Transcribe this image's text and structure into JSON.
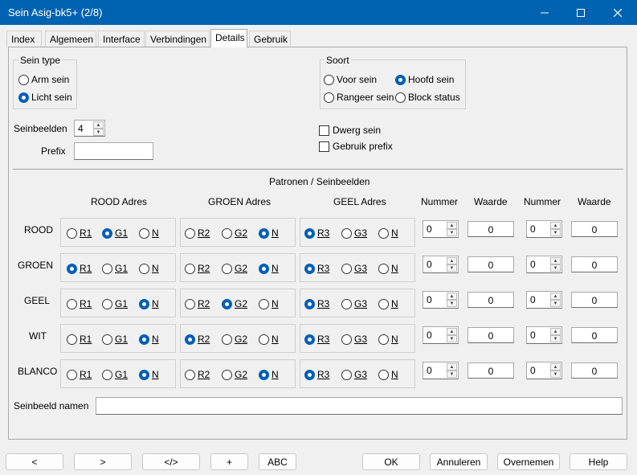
{
  "window": {
    "title": "Sein Asig-bk5+ (2/8)"
  },
  "tabs": [
    "Index",
    "Algemeen",
    "Interface",
    "Verbindingen",
    "Details",
    "Gebruik"
  ],
  "sein_type": {
    "label": "Sein type",
    "options": [
      {
        "label": "Arm sein",
        "selected": false
      },
      {
        "label": "Licht sein",
        "selected": true
      }
    ]
  },
  "soort": {
    "label": "Soort",
    "options": [
      {
        "label": "Voor sein",
        "selected": false
      },
      {
        "label": "Hoofd sein",
        "selected": true
      },
      {
        "label": "Rangeer sein",
        "selected": false
      },
      {
        "label": "Block status",
        "selected": false
      }
    ]
  },
  "seinbeelden": {
    "label": "Seinbeelden",
    "value": "4"
  },
  "prefix": {
    "label": "Prefix",
    "value": ""
  },
  "checkboxes": [
    {
      "label": "Dwerg sein",
      "checked": false
    },
    {
      "label": "Gebruik prefix",
      "checked": false
    }
  ],
  "patronen": {
    "title": "Patronen / Seinbeelden",
    "headers": [
      "ROOD Adres",
      "GROEN Adres",
      "GEEL Adres",
      "Nummer",
      "Waarde",
      "Nummer",
      "Waarde"
    ],
    "rows": [
      {
        "name": "ROOD",
        "rood": [
          "R1",
          "G1",
          "N"
        ],
        "rood_sel": 1,
        "groen": [
          "R2",
          "G2",
          "N"
        ],
        "groen_sel": 2,
        "geel": [
          "R3",
          "G3",
          "N"
        ],
        "geel_sel": 0,
        "n1": "0",
        "w1": "0",
        "n2": "0",
        "w2": "0"
      },
      {
        "name": "GROEN",
        "rood": [
          "R1",
          "G1",
          "N"
        ],
        "rood_sel": 0,
        "groen": [
          "R2",
          "G2",
          "N"
        ],
        "groen_sel": 2,
        "geel": [
          "R3",
          "G3",
          "N"
        ],
        "geel_sel": 0,
        "n1": "0",
        "w1": "0",
        "n2": "0",
        "w2": "0"
      },
      {
        "name": "GEEL",
        "rood": [
          "R1",
          "G1",
          "N"
        ],
        "rood_sel": 2,
        "groen": [
          "R2",
          "G2",
          "N"
        ],
        "groen_sel": 1,
        "geel": [
          "R3",
          "G3",
          "N"
        ],
        "geel_sel": 0,
        "n1": "0",
        "w1": "0",
        "n2": "0",
        "w2": "0"
      },
      {
        "name": "WIT",
        "rood": [
          "R1",
          "G1",
          "N"
        ],
        "rood_sel": 2,
        "groen": [
          "R2",
          "G2",
          "N"
        ],
        "groen_sel": 0,
        "geel": [
          "R3",
          "G3",
          "N"
        ],
        "geel_sel": 0,
        "n1": "0",
        "w1": "0",
        "n2": "0",
        "w2": "0"
      },
      {
        "name": "BLANCO",
        "rood": [
          "R1",
          "G1",
          "N"
        ],
        "rood_sel": 2,
        "groen": [
          "R2",
          "G2",
          "N"
        ],
        "groen_sel": 2,
        "geel": [
          "R3",
          "G3",
          "N"
        ],
        "geel_sel": 0,
        "n1": "0",
        "w1": "0",
        "n2": "0",
        "w2": "0"
      }
    ]
  },
  "seinbeeld_namen": {
    "label": "Seinbeeld namen",
    "value": ""
  },
  "buttons": {
    "prev": "<",
    "next": ">",
    "code": "</>",
    "plus": "+",
    "abc": "ABC",
    "ok": "OK",
    "annuleren": "Annuleren",
    "overnemen": "Overnemen",
    "help": "Help"
  },
  "colors": {
    "titlebar": "#0063b1",
    "radio_selected": "#005fb8"
  }
}
